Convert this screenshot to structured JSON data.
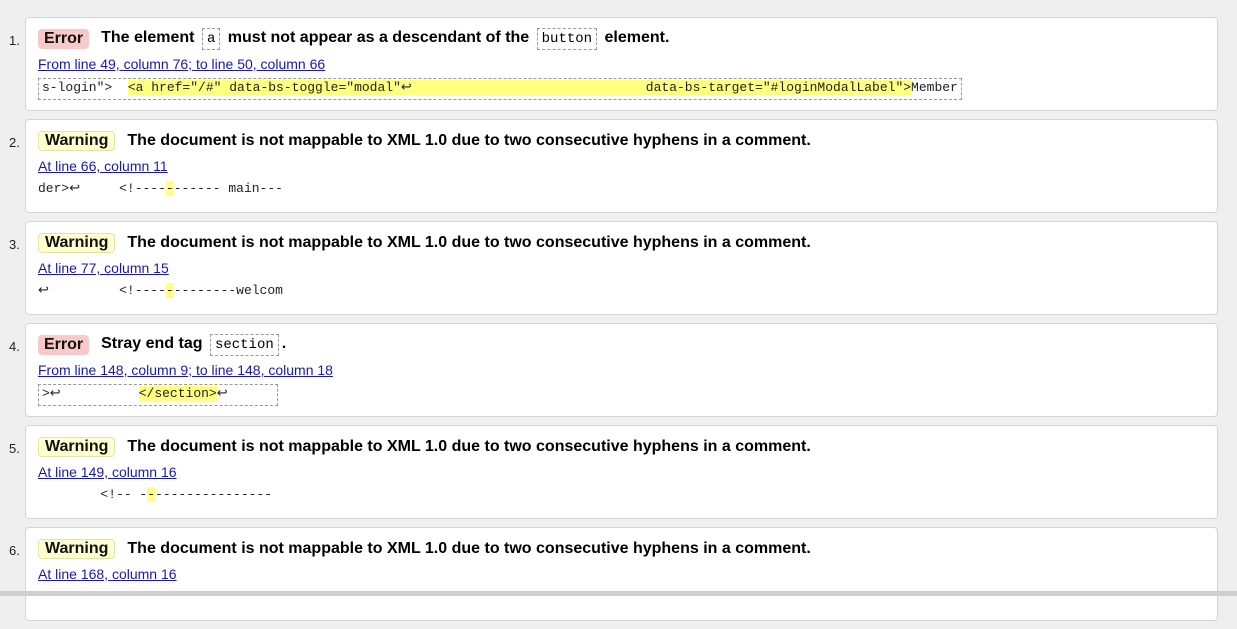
{
  "messages": [
    {
      "index": "1.",
      "type": "Error",
      "title_parts": [
        "The element",
        "a",
        "must not appear as a descendant of the",
        "button",
        "element."
      ],
      "location": "From line 49, column 76; to line 50, column 66",
      "extract_pre": "s-login\">  ",
      "extract_hl": "<a href=\"/#\" data-bs-toggle=\"modal\"↩                              data-bs-target=\"#loginModalLabel\">",
      "extract_post": "Member"
    },
    {
      "index": "2.",
      "type": "Warning",
      "title": "The document is not mappable to XML 1.0 due to two consecutive hyphens in a comment.",
      "location": "At line 66, column 11",
      "extract_pre": "der>↩     <!----",
      "extract_hl": "-",
      "extract_post": "------ main---"
    },
    {
      "index": "3.",
      "type": "Warning",
      "title": "The document is not mappable to XML 1.0 due to two consecutive hyphens in a comment.",
      "location": "At line 77, column 15",
      "extract_pre": "↩         <!----",
      "extract_hl": "-",
      "extract_post": "--------welcom"
    },
    {
      "index": "4.",
      "type": "Error",
      "title_parts": [
        "Stray end tag",
        "section",
        "."
      ],
      "location": "From line 148, column 9; to line 148, column 18",
      "extract_pre": ">↩          ",
      "extract_hl": "</section>",
      "extract_post": "↩      "
    },
    {
      "index": "5.",
      "type": "Warning",
      "title": "The document is not mappable to XML 1.0 due to two consecutive hyphens in a comment.",
      "location": "At line 149, column 16",
      "extract_pre": "        <!-- -",
      "extract_hl": "-",
      "extract_post": "---------------"
    },
    {
      "index": "6.",
      "type": "Warning",
      "title": "The document is not mappable to XML 1.0 due to two consecutive hyphens in a comment.",
      "location": "At line 168, column 16",
      "extract_pre": "",
      "extract_hl": "",
      "extract_post": ""
    }
  ],
  "colors": {
    "error_badge": "#f7c9c9",
    "warning_badge": "#ffffd0",
    "link": "#1a1aa6",
    "highlight": "#ffff80"
  }
}
